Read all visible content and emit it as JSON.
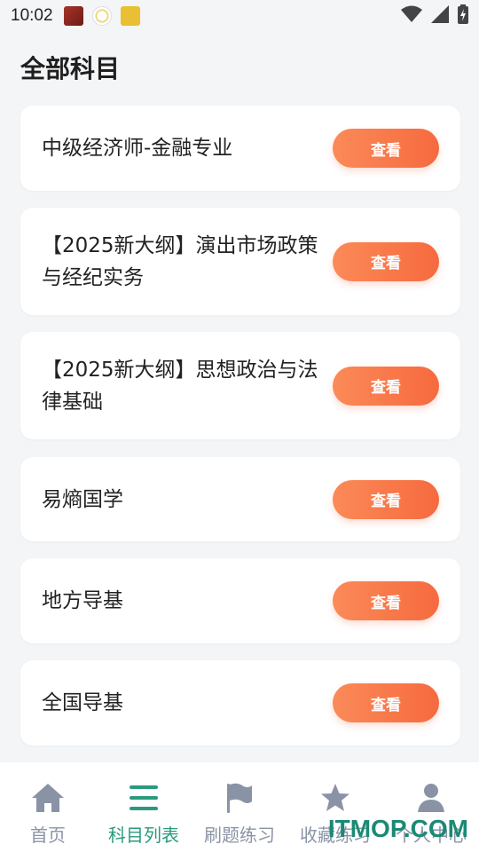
{
  "status_bar": {
    "time": "10:02",
    "notification_icons": [
      "app-icon-red",
      "app-icon-yk",
      "app-icon-yellow"
    ],
    "system_icons": [
      "wifi-icon",
      "signal-icon",
      "battery-charging-icon"
    ]
  },
  "page": {
    "title": "全部科目"
  },
  "subjects": [
    {
      "title": "中级经济师-金融专业",
      "button": "查看"
    },
    {
      "title": "【2025新大纲】演出市场政策与经纪实务",
      "button": "查看"
    },
    {
      "title": "【2025新大纲】思想政治与法律基础",
      "button": "查看"
    },
    {
      "title": "易熵国学",
      "button": "查看"
    },
    {
      "title": "地方导基",
      "button": "查看"
    },
    {
      "title": "全国导基",
      "button": "查看"
    }
  ],
  "bottom_nav": {
    "items": [
      {
        "label": "首页",
        "icon": "home-icon"
      },
      {
        "label": "科目列表",
        "icon": "list-icon",
        "active": true
      },
      {
        "label": "刷题练习",
        "icon": "flag-icon"
      },
      {
        "label": "收藏练习",
        "icon": "star-icon"
      },
      {
        "label": "个人中心",
        "icon": "user-icon"
      }
    ]
  },
  "colors": {
    "accent_orange": "#f66a3f",
    "active_green": "#2a9a7d",
    "inactive_gray": "#8a93a6"
  },
  "watermark": "ITMOP.COM"
}
